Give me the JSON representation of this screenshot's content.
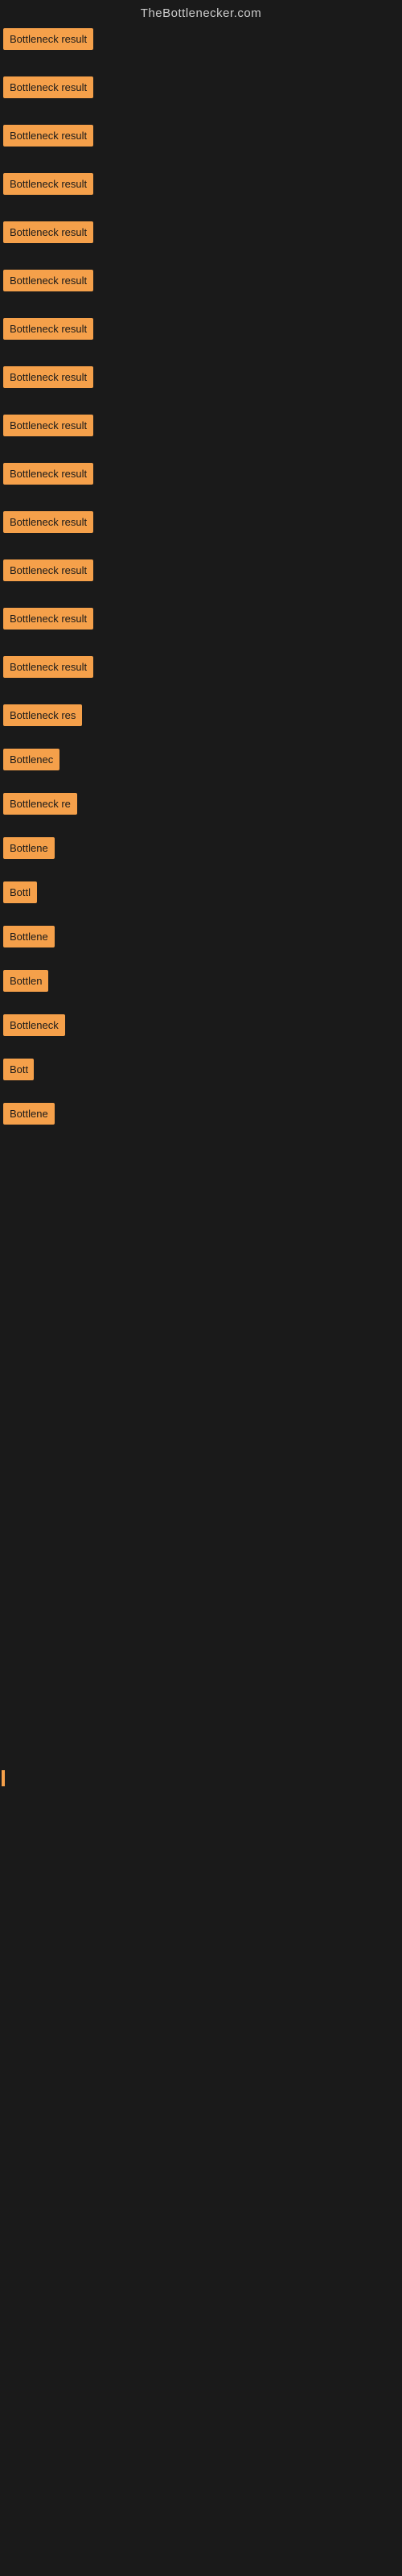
{
  "site": {
    "title": "TheBottlenecker.com"
  },
  "items": [
    {
      "label": "Bottleneck result",
      "width": "full"
    },
    {
      "label": "Bottleneck result",
      "width": "full"
    },
    {
      "label": "Bottleneck result",
      "width": "full"
    },
    {
      "label": "Bottleneck result",
      "width": "full"
    },
    {
      "label": "Bottleneck result",
      "width": "full"
    },
    {
      "label": "Bottleneck result",
      "width": "full"
    },
    {
      "label": "Bottleneck result",
      "width": "full"
    },
    {
      "label": "Bottleneck result",
      "width": "full"
    },
    {
      "label": "Bottleneck result",
      "width": "full"
    },
    {
      "label": "Bottleneck result",
      "width": "full"
    },
    {
      "label": "Bottleneck result",
      "width": "full"
    },
    {
      "label": "Bottleneck result",
      "width": "full"
    },
    {
      "label": "Bottleneck result",
      "width": "full"
    },
    {
      "label": "Bottleneck result",
      "width": "full"
    },
    {
      "label": "Bottleneck res",
      "width": "partial"
    },
    {
      "label": "Bottlenec",
      "width": "short"
    },
    {
      "label": "Bottleneck re",
      "width": "partial"
    },
    {
      "label": "Bottlene",
      "width": "shorter"
    },
    {
      "label": "Bottl",
      "width": "tiny"
    },
    {
      "label": "Bottlene",
      "width": "shorter"
    },
    {
      "label": "Bottlen",
      "width": "shorter2"
    },
    {
      "label": "Bottleneck",
      "width": "medium"
    },
    {
      "label": "Bott",
      "width": "tiny2"
    },
    {
      "label": "Bottlene",
      "width": "shorter"
    }
  ],
  "accent_color": "#f5a04a",
  "bg_color": "#1a1a1a",
  "text_color": "#cccccc"
}
